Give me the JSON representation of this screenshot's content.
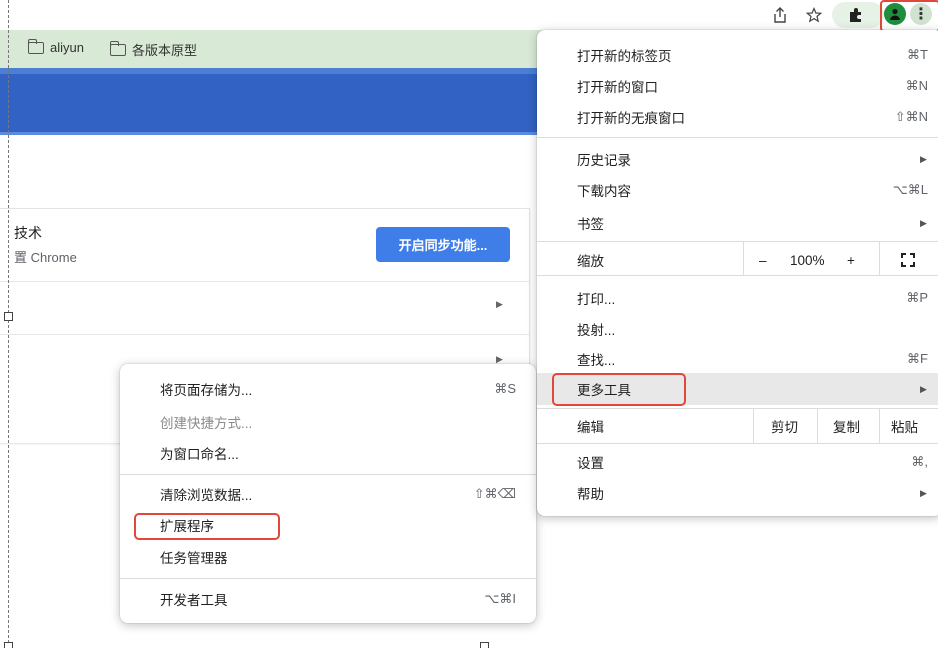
{
  "toolbar": {
    "icons": [
      "share-icon",
      "star-icon",
      "puzzle-icon",
      "profile-icon",
      "kebab-menu-icon"
    ]
  },
  "bookmarks": {
    "items": [
      {
        "label": "aliyun"
      },
      {
        "label": "各版本原型"
      }
    ]
  },
  "settings_card": {
    "title": "技术",
    "subtitle": "置 Chrome",
    "sync_button": "开启同步功能..."
  },
  "main_menu": {
    "new_tab": {
      "label": "打开新的标签页",
      "shortcut": "⌘T"
    },
    "new_window": {
      "label": "打开新的窗口",
      "shortcut": "⌘N"
    },
    "incognito": {
      "label": "打开新的无痕窗口",
      "shortcut": "⇧⌘N"
    },
    "history": {
      "label": "历史记录"
    },
    "downloads": {
      "label": "下载内容",
      "shortcut": "⌥⌘L"
    },
    "bookmarks": {
      "label": "书签"
    },
    "zoom": {
      "label": "缩放",
      "minus": "–",
      "value": "100%",
      "plus": "+"
    },
    "print": {
      "label": "打印...",
      "shortcut": "⌘P"
    },
    "cast": {
      "label": "投射..."
    },
    "find": {
      "label": "查找...",
      "shortcut": "⌘F"
    },
    "more_tools": {
      "label": "更多工具"
    },
    "edit": {
      "label": "编辑",
      "cut": "剪切",
      "copy": "复制",
      "paste": "粘贴"
    },
    "settings": {
      "label": "设置",
      "shortcut": "⌘,"
    },
    "help": {
      "label": "帮助"
    }
  },
  "sub_menu": {
    "save_page": {
      "label": "将页面存储为...",
      "shortcut": "⌘S"
    },
    "create_shortcut": {
      "label": "创建快捷方式..."
    },
    "name_window": {
      "label": "为窗口命名..."
    },
    "clear_data": {
      "label": "清除浏览数据...",
      "shortcut": "⇧⌘⌫"
    },
    "extensions": {
      "label": "扩展程序"
    },
    "task_manager": {
      "label": "任务管理器"
    },
    "dev_tools": {
      "label": "开发者工具",
      "shortcut": "⌥⌘I"
    }
  },
  "colors": {
    "highlight_box": "#e2473b",
    "bookmark_bar": "#d8ead6",
    "header_blue": "#3263c4",
    "sync_button": "#3f7de8"
  }
}
